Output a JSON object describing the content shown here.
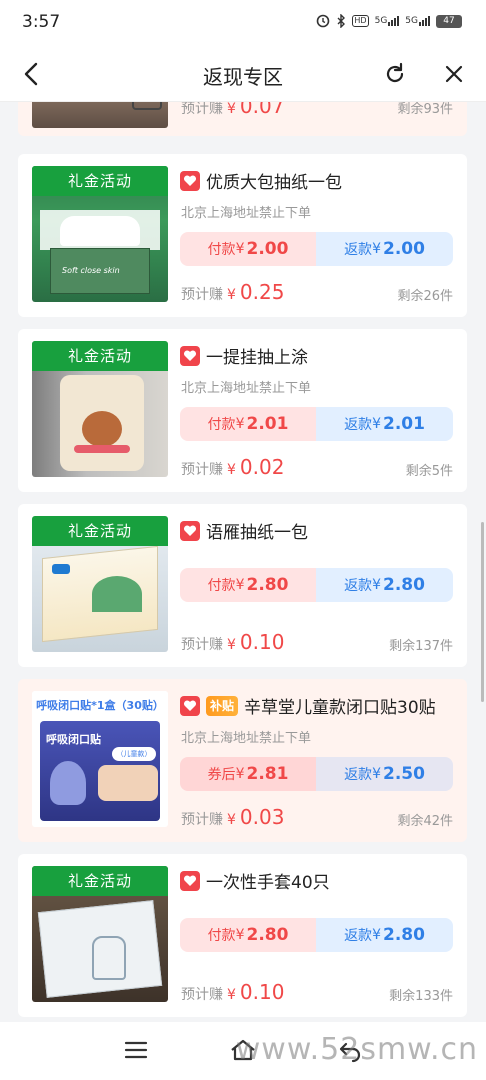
{
  "status_bar": {
    "time": "3:57",
    "hd": "HD",
    "net1": "5G",
    "net2": "5G",
    "battery": "47"
  },
  "nav": {
    "title": "返现专区"
  },
  "partial_card": {
    "earn_label": "预计赚",
    "earn_currency": "¥",
    "earn_value": "0.07",
    "remain": "剩余93件"
  },
  "items": [
    {
      "badge": "礼金活动",
      "title": "优质大包抽纸一包",
      "address": "北京上海地址禁止下单",
      "pay_label": "付款",
      "pay_currency": "¥",
      "pay_value": "2.00",
      "refund_label": "返款",
      "refund_currency": "¥",
      "refund_value": "2.00",
      "earn_label": "预计赚",
      "earn_currency": "¥",
      "earn_value": "0.25",
      "remain": "剩余26件",
      "img_text": "Soft close skin"
    },
    {
      "badge": "礼金活动",
      "title": "一提挂抽上涂",
      "address": "北京上海地址禁止下单",
      "pay_label": "付款",
      "pay_currency": "¥",
      "pay_value": "2.01",
      "refund_label": "返款",
      "refund_currency": "¥",
      "refund_value": "2.01",
      "earn_label": "预计赚",
      "earn_currency": "¥",
      "earn_value": "0.02",
      "remain": "剩余5件",
      "img_text": ""
    },
    {
      "badge": "礼金活动",
      "title": "语雁抽纸一包",
      "address": "",
      "pay_label": "付款",
      "pay_currency": "¥",
      "pay_value": "2.80",
      "refund_label": "返款",
      "refund_currency": "¥",
      "refund_value": "2.80",
      "earn_label": "预计赚",
      "earn_currency": "¥",
      "earn_value": "0.10",
      "remain": "剩余137件",
      "img_text": ""
    },
    {
      "badge": "",
      "bu_tag": "补贴",
      "title": "辛草堂儿童款闭口贴30贴",
      "address": "北京上海地址禁止下单",
      "pay_label": "券后",
      "pay_currency": "¥",
      "pay_value": "2.81",
      "refund_label": "返款",
      "refund_currency": "¥",
      "refund_value": "2.50",
      "earn_label": "预计赚",
      "earn_currency": "¥",
      "earn_value": "0.03",
      "remain": "剩余42件",
      "img_text": "呼吸闭口贴*1盒（30贴）",
      "img_text2": "呼吸闭口贴",
      "img_text3": "（儿童款）"
    },
    {
      "badge": "礼金活动",
      "title": "一次性手套40只",
      "address": "",
      "pay_label": "付款",
      "pay_currency": "¥",
      "pay_value": "2.80",
      "refund_label": "返款",
      "refund_currency": "¥",
      "refund_value": "2.80",
      "earn_label": "预计赚",
      "earn_currency": "¥",
      "earn_value": "0.10",
      "remain": "剩余133件",
      "img_text": ""
    }
  ],
  "watermark": "www.52smw.cn"
}
